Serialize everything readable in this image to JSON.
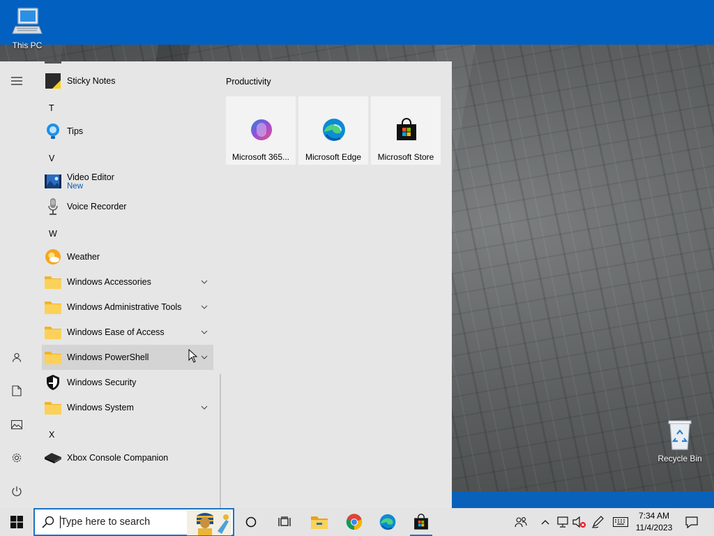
{
  "desktop": {
    "icons": [
      {
        "label": "This PC",
        "icon": "computer-icon"
      },
      {
        "label": "Recycle Bin",
        "icon": "recycle-bin-icon"
      }
    ]
  },
  "start_menu": {
    "rail": [
      "hamburger-menu-icon",
      "user-icon",
      "document-icon",
      "pictures-icon",
      "settings-icon",
      "power-icon"
    ],
    "apps": [
      {
        "type": "app",
        "label": "Sticky Notes",
        "icon": "sticky-notes-icon"
      },
      {
        "type": "letter",
        "label": "T"
      },
      {
        "type": "app",
        "label": "Tips",
        "icon": "tips-icon"
      },
      {
        "type": "letter",
        "label": "V"
      },
      {
        "type": "app",
        "label": "Video Editor",
        "sublabel": "New",
        "icon": "video-editor-icon"
      },
      {
        "type": "app",
        "label": "Voice Recorder",
        "icon": "microphone-icon"
      },
      {
        "type": "letter",
        "label": "W"
      },
      {
        "type": "app",
        "label": "Weather",
        "icon": "weather-icon"
      },
      {
        "type": "folder",
        "label": "Windows Accessories",
        "icon": "folder-icon"
      },
      {
        "type": "folder",
        "label": "Windows Administrative Tools",
        "icon": "folder-icon"
      },
      {
        "type": "folder",
        "label": "Windows Ease of Access",
        "icon": "folder-icon"
      },
      {
        "type": "folder",
        "label": "Windows PowerShell",
        "icon": "folder-icon",
        "hovered": true
      },
      {
        "type": "app",
        "label": "Windows Security",
        "icon": "shield-icon"
      },
      {
        "type": "folder",
        "label": "Windows System",
        "icon": "folder-icon"
      },
      {
        "type": "letter",
        "label": "X"
      },
      {
        "type": "app",
        "label": "Xbox Console Companion",
        "icon": "xbox-icon"
      }
    ],
    "tiles_group": "Productivity",
    "tiles": [
      {
        "label": "Microsoft 365...",
        "icon": "microsoft-365-icon"
      },
      {
        "label": "Microsoft Edge",
        "icon": "edge-icon"
      },
      {
        "label": "Microsoft Store",
        "icon": "store-icon"
      }
    ]
  },
  "taskbar": {
    "search_placeholder": "Type here to search",
    "pinned": [
      "cortana-icon",
      "task-view-icon",
      "file-explorer-icon",
      "chrome-icon",
      "edge-icon",
      "store-icon"
    ],
    "tray": [
      "people-icon",
      "chevron-up-icon",
      "network-icon",
      "volume-muted-icon",
      "pen-icon",
      "keyboard-icon"
    ],
    "time": "7:34 AM",
    "date": "11/4/2023",
    "notification": "action-center-icon"
  }
}
